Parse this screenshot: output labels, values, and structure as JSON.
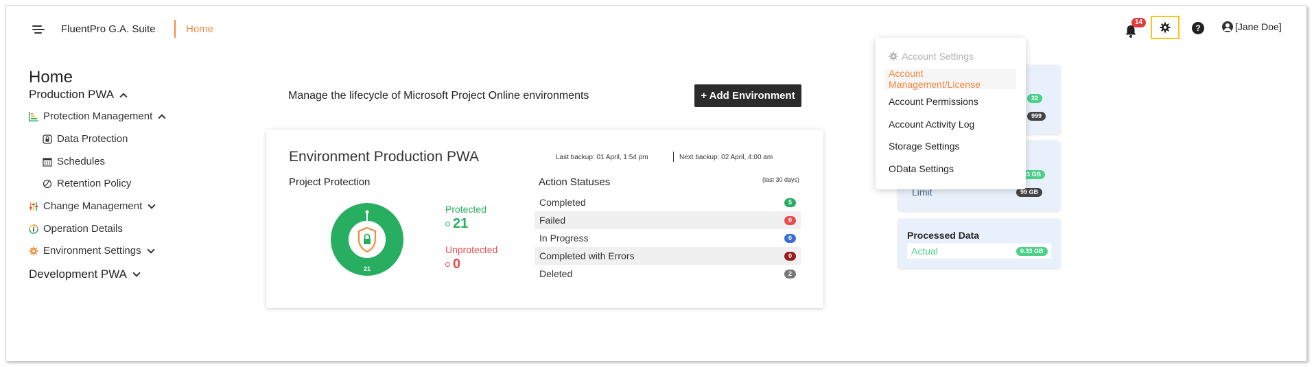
{
  "header": {
    "app_title": "FluentPro G.A. Suite",
    "breadcrumb": "Home",
    "notification_count": "14",
    "user_name": "[Jane Doe]",
    "help_glyph": "?",
    "accent_color": "#f08a3c"
  },
  "sidebar": {
    "page_title": "Home",
    "production": "Production PWA",
    "protection_management": "Protection Management",
    "data_protection": "Data Protection",
    "schedules": "Schedules",
    "retention_policy": "Retention Policy",
    "change_management": "Change Management",
    "operation_details": "Operation Details",
    "environment_settings": "Environment Settings",
    "development": "Development PWA"
  },
  "main": {
    "description": "Manage the lifecycle of Microsoft Project Online environments",
    "add_button": "+ Add Environment",
    "env_card": {
      "title": "Environment Production PWA",
      "last_backup": "Last backup: 01 April, 1:54 pm",
      "next_backup": "Next backup: 02 April, 4:00 am",
      "project_protection": {
        "title": "Project Protection",
        "donut_total": "21",
        "protected_label": "Protected",
        "protected_value": "21",
        "unprotected_label": "Unprotected",
        "unprotected_value": "0",
        "protected_color": "#27ae60",
        "unprotected_color": "#e74c4c"
      },
      "action_statuses": {
        "title": "Action Statuses",
        "subtitle": "(last 30 days)",
        "rows": [
          {
            "label": "Completed",
            "count": "5",
            "color": "#27ae60"
          },
          {
            "label": "Failed",
            "count": "0",
            "color": "#e74c4c"
          },
          {
            "label": "In Progress",
            "count": "0",
            "color": "#3b6fd4"
          },
          {
            "label": "Completed with Errors",
            "count": "0",
            "color": "#9b1c1c"
          },
          {
            "label": "Deleted",
            "count": "2",
            "color": "#777777"
          }
        ]
      }
    }
  },
  "right_cards": {
    "card1_pill_a": "22",
    "card1_pill_b": "999",
    "card2_pill_a": "03 GB",
    "card2_limit_label": "Limit",
    "card2_limit_value": "99 GB",
    "processed_title": "Processed Data",
    "processed_label": "Actual",
    "processed_value": "0.33 GB"
  },
  "dropdown": {
    "header": "Account Settings",
    "items": [
      "Account Management/License",
      "Account Permissions",
      "Account Activity Log",
      "Storage Settings",
      "OData Settings"
    ]
  }
}
